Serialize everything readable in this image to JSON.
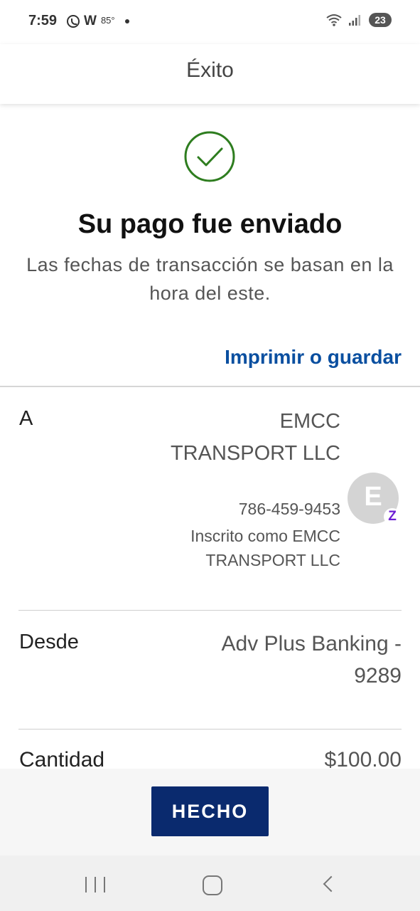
{
  "status_bar": {
    "time": "7:59",
    "weather_letter": "W",
    "temperature": "85°",
    "battery_level": "23",
    "icons": [
      "whatsapp-icon",
      "wifi-icon",
      "signal-icon",
      "battery-icon"
    ]
  },
  "header": {
    "title": "Éxito"
  },
  "success": {
    "icon": "check-circle-icon",
    "headline": "Su pago fue enviado",
    "subtext": "Las fechas de transacción se basan en la hora del este.",
    "print_link": "Imprimir o guardar"
  },
  "details": {
    "to": {
      "label": "A",
      "name": "EMCC TRANSPORT LLC",
      "phone": "786-459-9453",
      "enrolled": "Inscrito como EMCC TRANSPORT LLC",
      "avatar_letter": "E",
      "badge": "Z"
    },
    "from": {
      "label": "Desde",
      "value": "Adv Plus Banking - 9289"
    },
    "amount": {
      "label": "Cantidad",
      "value": "$100.00"
    }
  },
  "footer": {
    "done_label": "HECHO"
  },
  "colors": {
    "success_green": "#2e7d1f",
    "link_blue": "#0a4fa0",
    "button_navy": "#0a2a6e",
    "zelle_purple": "#6d1ed4"
  }
}
